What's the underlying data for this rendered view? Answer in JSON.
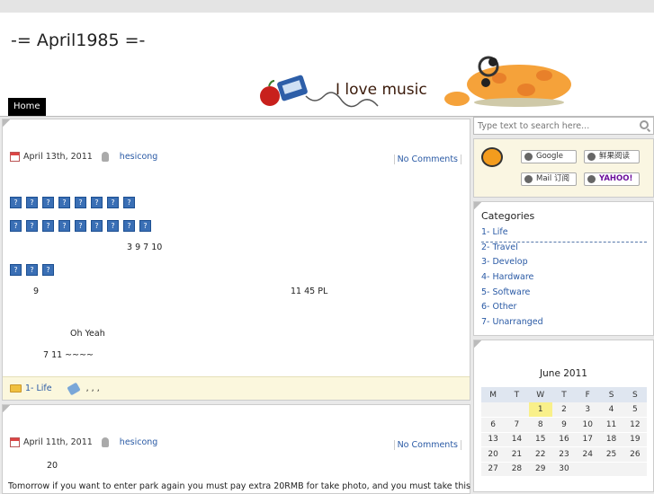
{
  "site": {
    "title": "-= April1985 =-"
  },
  "banner": {
    "text": "I love music"
  },
  "nav": {
    "home": "Home"
  },
  "post1": {
    "date": "April 13th, 2011",
    "author": "hesicong",
    "comments": "No Comments",
    "row1_glyphs": [
      "?",
      "?",
      "?",
      "?",
      "?",
      "?",
      "?",
      "?"
    ],
    "row2_glyphs": [
      "?",
      "?",
      "?",
      "?",
      "?",
      "?",
      "?",
      "?",
      "?"
    ],
    "row3_glyphs": [
      "?",
      "?",
      "?"
    ],
    "frag1": "3  9      7      10",
    "frag2": "9",
    "frag3": "11 45      PL",
    "frag4": "Oh Yeah",
    "frag5": "7          11                ~~~~",
    "category": "1-   Life",
    "tags": ", , ,"
  },
  "post2": {
    "date": "April 11th, 2011",
    "author": "hesicong",
    "comments": "No Comments",
    "frag1": "20",
    "body": "Tomorrow if you want to enter park again you must pay extra 20RMB for take photo, and you must take this ticket at"
  },
  "search": {
    "placeholder": "Type text to search here..."
  },
  "feeds": {
    "google": "Google",
    "xianguo": "鲜果阅读",
    "mail": "Mail 订阅",
    "yahoo": "YAHOO!"
  },
  "categories": {
    "title": "Categories",
    "items": [
      {
        "label": "1-   Life"
      },
      {
        "label": "2-   Travel"
      },
      {
        "label": "3-   Develop"
      },
      {
        "label": "4-   Hardware"
      },
      {
        "label": "5-   Software"
      },
      {
        "label": "6-   Other"
      },
      {
        "label": "7-    Unarranged"
      }
    ]
  },
  "calendar": {
    "title": "June 2011",
    "weekdays": [
      "M",
      "T",
      "W",
      "T",
      "F",
      "S",
      "S"
    ],
    "weeks": [
      [
        "",
        "",
        "1",
        "2",
        "3",
        "4",
        "5"
      ],
      [
        "6",
        "7",
        "8",
        "9",
        "10",
        "11",
        "12"
      ],
      [
        "13",
        "14",
        "15",
        "16",
        "17",
        "18",
        "19"
      ],
      [
        "20",
        "21",
        "22",
        "23",
        "24",
        "25",
        "26"
      ],
      [
        "27",
        "28",
        "29",
        "30",
        "",
        "",
        ""
      ]
    ]
  }
}
